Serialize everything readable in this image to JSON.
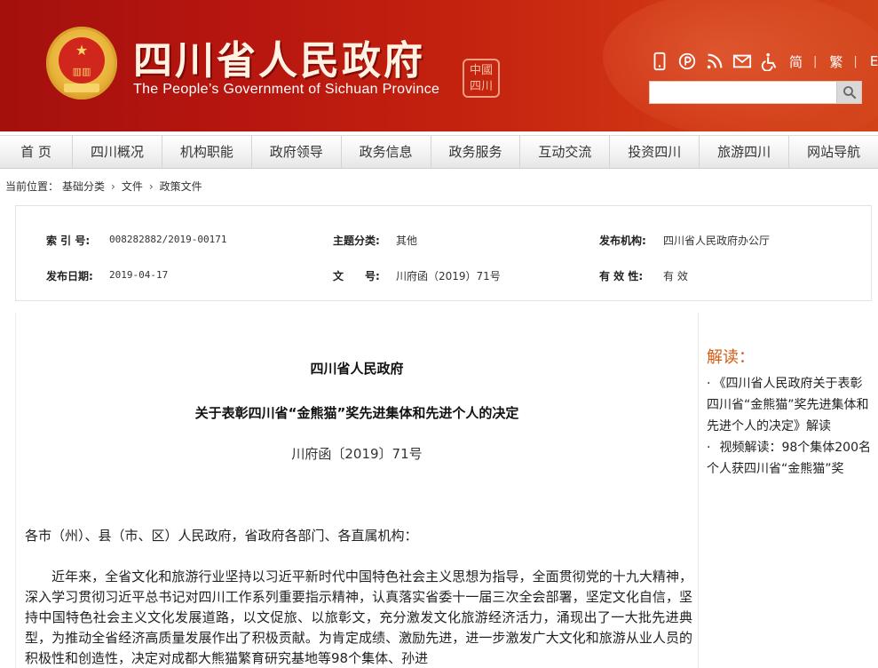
{
  "header": {
    "title": "四川省人民政府",
    "subtitle": "The People’s Government of Sichuan Province",
    "seal_text": "中国四川",
    "emblem_text": "★\n天安门",
    "lang_simplified": "简",
    "lang_traditional": "繁",
    "lang_english": "EN",
    "search_placeholder": ""
  },
  "nav": {
    "items": [
      "首 页",
      "四川概况",
      "机构职能",
      "政府领导",
      "政务信息",
      "政务服务",
      "互动交流",
      "投资四川",
      "旅游四川",
      "网站导航"
    ]
  },
  "breadcrumb": {
    "label": "当前位置：",
    "items": [
      "基础分类",
      "文件",
      "政策文件"
    ],
    "separator": "›"
  },
  "meta": {
    "index_label": "索 引 号:",
    "index_value": "008282882/2019-00171",
    "topic_label": "主题分类:",
    "topic_value": "其他",
    "publisher_label": "发布机构:",
    "publisher_value": "四川省人民政府办公厅",
    "date_label": "发布日期:",
    "date_value": "2019-04-17",
    "docno_label": "文　　号:",
    "docno_value": "川府函（2019）71号",
    "validity_label": "有 效 性:",
    "validity_value": "有 效"
  },
  "article": {
    "org": "四川省人民政府",
    "title": "关于表彰四川省“金熊猫”奖先进集体和先进个人的决定",
    "doc_number": "川府函〔2019〕71号",
    "addressee": "各市（州）、县（市、区）人民政府，省政府各部门、各直属机构：",
    "paragraph": "近年来，全省文化和旅游行业坚持以习近平新时代中国特色社会主义思想为指导，全面贯彻党的十九大精神，深入学习贯彻习近平总书记对四川工作系列重要指示精神，认真落实省委十一届三次全会部署，坚定文化自信，坚持中国特色社会主义文化发展道路，以文促旅、以旅彰文，充分激发文化旅游经济活力，涌现出了一大批先进典型，为推动全省经济高质量发展作出了积极贡献。为肯定成绩、激励先进，进一步激发广大文化和旅游从业人员的积极性和创造性，决定对成都大熊猫繁育研究基地等98个集体、孙进"
  },
  "sidebar": {
    "title": "解读：",
    "items": [
      "《四川省人民政府关于表彰四川省“金熊猫”奖先进集体和先进个人的决定》解读",
      "视频解读：98个集体200名个人获四川省“金熊猫”奖"
    ],
    "bullet": "·"
  },
  "colors": {
    "header_red": "#b8170f",
    "accent_orange": "#d65a12"
  },
  "icons": [
    "mobile-icon",
    "weibo-icon",
    "rss-icon",
    "mail-icon",
    "accessibility-icon",
    "search-icon"
  ]
}
